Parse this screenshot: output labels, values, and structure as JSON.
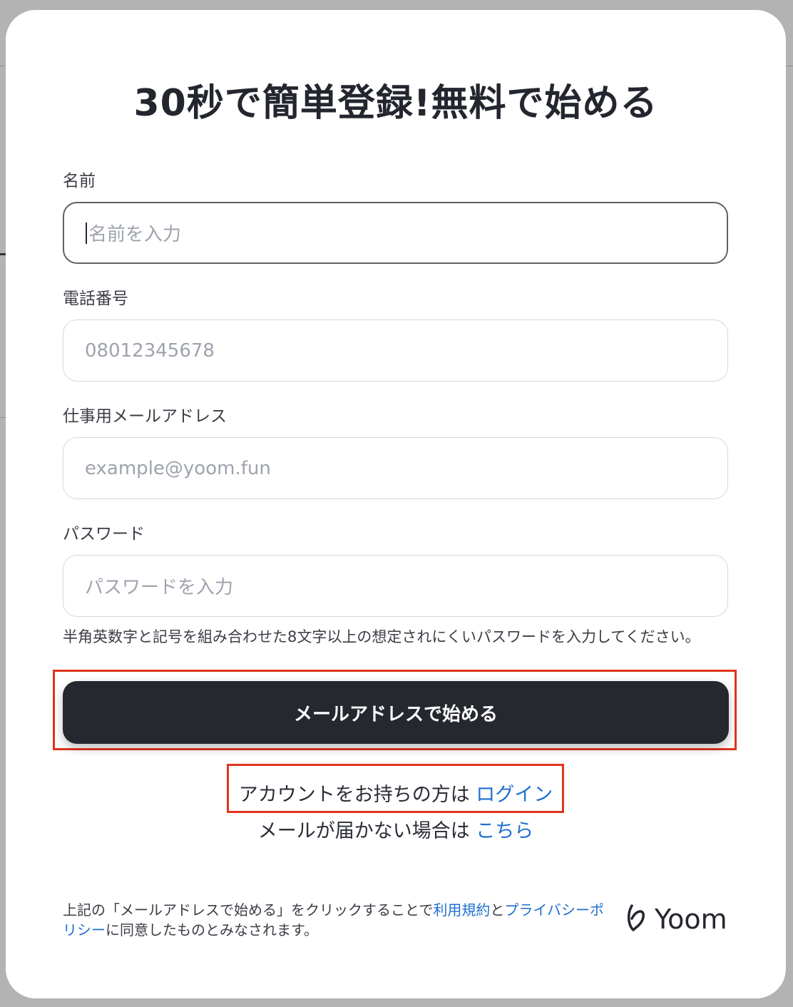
{
  "modal": {
    "title": "30秒で簡単登録!無料で始める",
    "fields": [
      {
        "label": "名前",
        "placeholder": "名前を入力",
        "value": ""
      },
      {
        "label": "電話番号",
        "placeholder": "08012345678",
        "value": ""
      },
      {
        "label": "仕事用メールアドレス",
        "placeholder": "example@yoom.fun",
        "value": ""
      },
      {
        "label": "パスワード",
        "placeholder": "パスワードを入力",
        "value": ""
      }
    ],
    "password_hint": "半角英数字と記号を組み合わせた8文字以上の想定されにくいパスワードを入力してください。",
    "submit_label": "メールアドレスで始める",
    "login_prompt": "アカウントをお持ちの方は ",
    "login_link": "ログイン",
    "resend_prompt": "メールが届かない場合は ",
    "resend_link": "こちら",
    "footer": {
      "prefix": "上記の「メールアドレスで始める」をクリックすることで",
      "terms_link": "利用規約",
      "and": "と",
      "privacy_link": "プライバシーポリシー",
      "suffix": "に同意したものとみなされます。"
    },
    "logo_text": "Yoom"
  },
  "colors": {
    "primary_button": "#262830",
    "link": "#1e6fcf",
    "highlight": "#e0351f"
  }
}
